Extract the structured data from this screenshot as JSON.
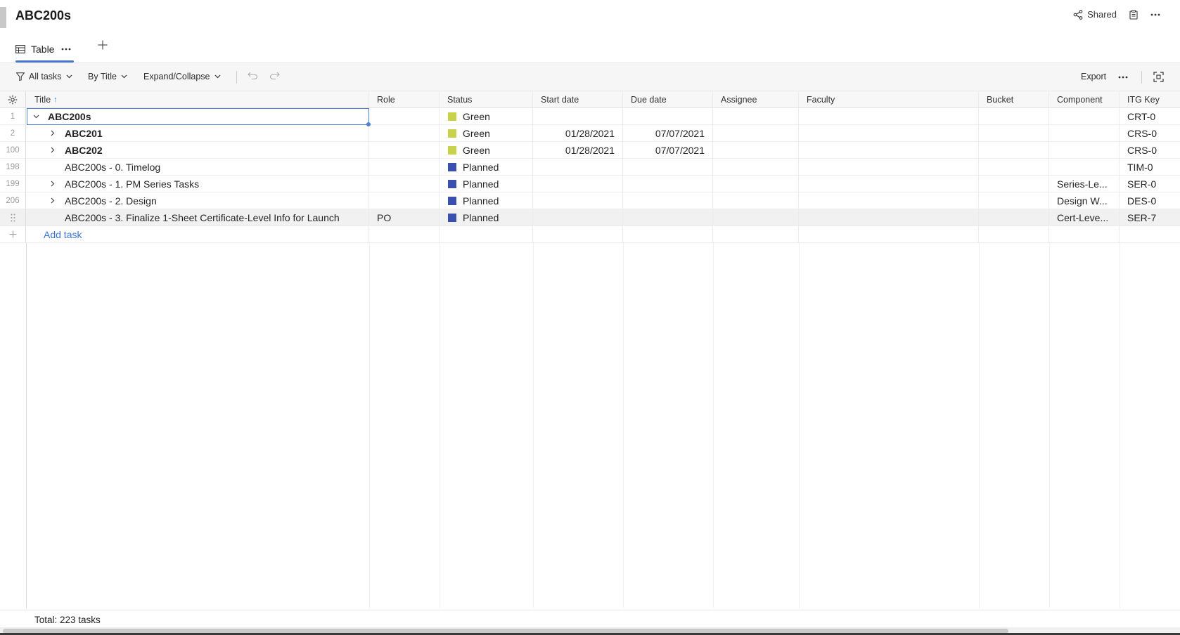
{
  "header": {
    "title": "ABC200s",
    "shared_label": "Shared"
  },
  "views": {
    "active_tab_label": "Table"
  },
  "toolbar": {
    "filter_label": "All tasks",
    "group_label": "By Title",
    "expand_label": "Expand/Collapse",
    "export_label": "Export"
  },
  "columns": {
    "title": "Title",
    "role": "Role",
    "status": "Status",
    "start_date": "Start date",
    "due_date": "Due date",
    "assignee": "Assignee",
    "faculty": "Faculty",
    "bucket": "Bucket",
    "component": "Component",
    "itg_key": "ITG Key"
  },
  "rows": [
    {
      "num": "1",
      "title": "ABC200s",
      "role": "",
      "status": "Green",
      "status_color": "#c9d34a",
      "start": "",
      "due": "",
      "component": "",
      "key": "CRT-0"
    },
    {
      "num": "2",
      "title": "ABC201",
      "role": "",
      "status": "Green",
      "status_color": "#c9d34a",
      "start": "01/28/2021",
      "due": "07/07/2021",
      "component": "",
      "key": "CRS-0"
    },
    {
      "num": "100",
      "title": "ABC202",
      "role": "",
      "status": "Green",
      "status_color": "#c9d34a",
      "start": "01/28/2021",
      "due": "07/07/2021",
      "component": "",
      "key": "CRS-0"
    },
    {
      "num": "198",
      "title": "ABC200s - 0. Timelog",
      "role": "",
      "status": "Planned",
      "status_color": "#3a4fae",
      "start": "",
      "due": "",
      "component": "",
      "key": "TIM-0"
    },
    {
      "num": "199",
      "title": "ABC200s - 1. PM Series Tasks",
      "role": "",
      "status": "Planned",
      "status_color": "#3a4fae",
      "start": "",
      "due": "",
      "component": "Series-Le...",
      "key": "SER-0"
    },
    {
      "num": "206",
      "title": "ABC200s - 2. Design",
      "role": "",
      "status": "Planned",
      "status_color": "#3a4fae",
      "start": "",
      "due": "",
      "component": "Design W...",
      "key": "DES-0"
    },
    {
      "num": "",
      "title": "ABC200s - 3. Finalize 1-Sheet Certificate-Level Info for Launch",
      "role": "PO",
      "status": "Planned",
      "status_color": "#3a4fae",
      "start": "",
      "due": "",
      "component": "Cert-Leve...",
      "key": "SER-7"
    }
  ],
  "add_task_label": "Add task",
  "footer": {
    "total_label": "Total: 223 tasks"
  }
}
